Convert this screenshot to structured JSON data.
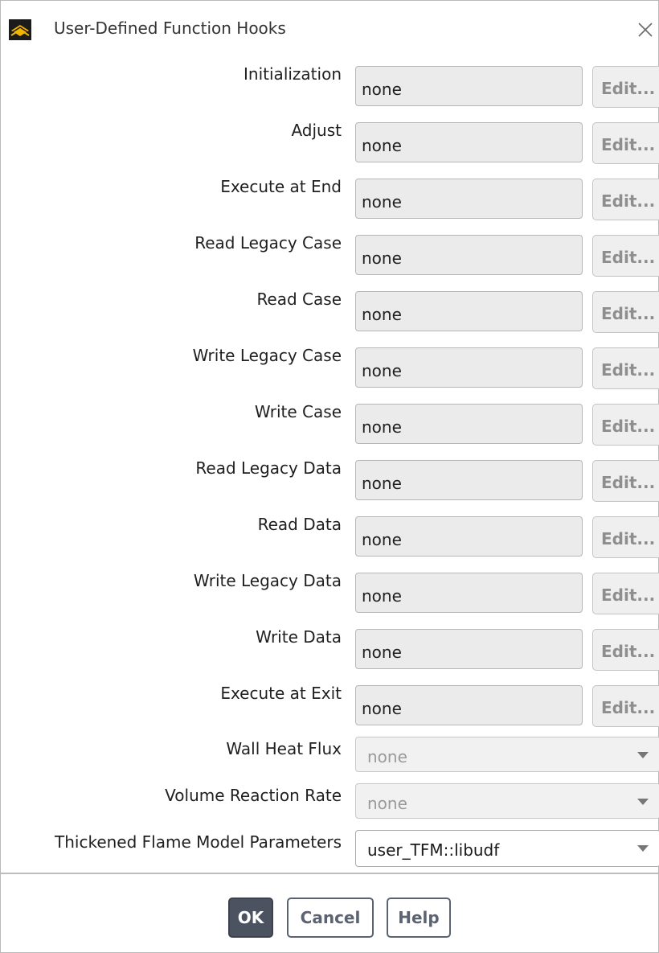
{
  "window": {
    "title": "User-Defined Function Hooks",
    "icon": "ansys-fluent-logo-icon"
  },
  "hooks": [
    {
      "label": "Initialization",
      "value": "none",
      "edit_label": "Edit..."
    },
    {
      "label": "Adjust",
      "value": "none",
      "edit_label": "Edit..."
    },
    {
      "label": "Execute at End",
      "value": "none",
      "edit_label": "Edit..."
    },
    {
      "label": "Read Legacy Case",
      "value": "none",
      "edit_label": "Edit..."
    },
    {
      "label": "Read Case",
      "value": "none",
      "edit_label": "Edit..."
    },
    {
      "label": "Write Legacy Case",
      "value": "none",
      "edit_label": "Edit..."
    },
    {
      "label": "Write Case",
      "value": "none",
      "edit_label": "Edit..."
    },
    {
      "label": "Read Legacy Data",
      "value": "none",
      "edit_label": "Edit..."
    },
    {
      "label": "Read Data",
      "value": "none",
      "edit_label": "Edit..."
    },
    {
      "label": "Write Legacy Data",
      "value": "none",
      "edit_label": "Edit..."
    },
    {
      "label": "Write Data",
      "value": "none",
      "edit_label": "Edit..."
    },
    {
      "label": "Execute at Exit",
      "value": "none",
      "edit_label": "Edit..."
    }
  ],
  "selects": [
    {
      "label": "Wall Heat Flux",
      "value": "none",
      "enabled": false
    },
    {
      "label": "Volume Reaction Rate",
      "value": "none",
      "enabled": false
    },
    {
      "label": "Thickened Flame Model Parameters",
      "value": "user_TFM::libudf",
      "enabled": true
    }
  ],
  "buttons": {
    "ok": "OK",
    "cancel": "Cancel",
    "help": "Help"
  },
  "colors": {
    "primary_button": "#4b5260",
    "secondary_button_border": "#5b6272",
    "field_background": "#ebebeb"
  }
}
